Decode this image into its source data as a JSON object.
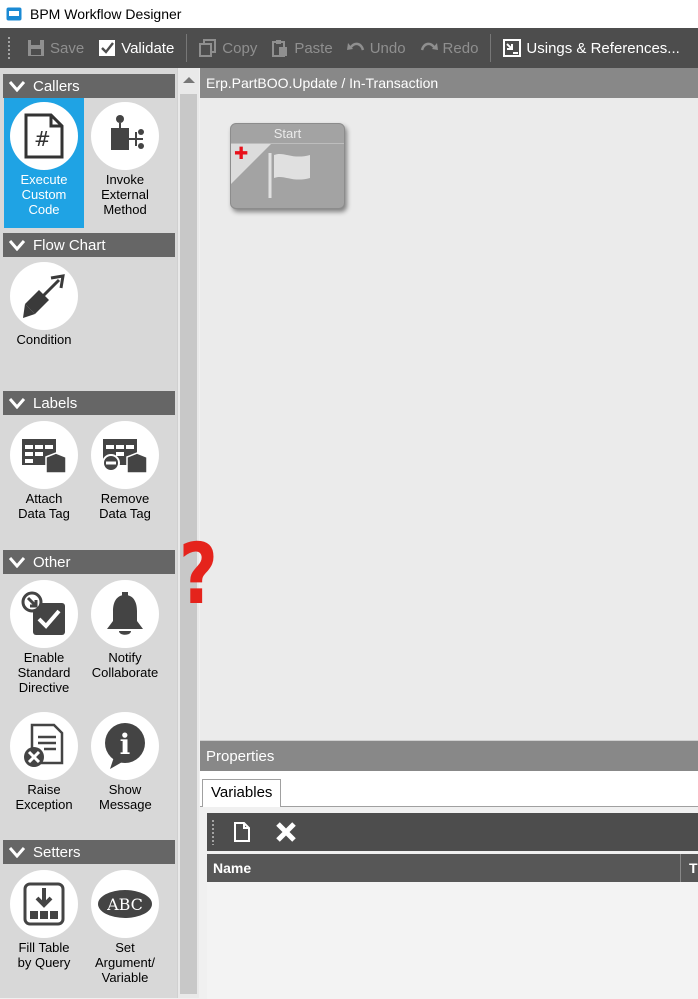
{
  "window": {
    "title": "BPM Workflow Designer",
    "app_icon": "window-icon"
  },
  "toolbar": {
    "save": "Save",
    "validate": "Validate",
    "copy": "Copy",
    "paste": "Paste",
    "undo": "Undo",
    "redo": "Redo",
    "usings": "Usings & References..."
  },
  "palette": {
    "categories": [
      {
        "label": "Callers",
        "tools": [
          {
            "label": "Execute Custom Code",
            "icon": "code-file-icon",
            "selected": true
          },
          {
            "label": "Invoke External Method",
            "icon": "external-method-icon"
          }
        ]
      },
      {
        "label": "Flow Chart",
        "tools": [
          {
            "label": "Condition",
            "icon": "condition-arrows-icon"
          }
        ]
      },
      {
        "label": "Labels",
        "tools": [
          {
            "label": "Attach Data Tag",
            "icon": "attach-tag-icon"
          },
          {
            "label": "Remove Data Tag",
            "icon": "remove-tag-icon"
          }
        ]
      },
      {
        "label": "Other",
        "tools": [
          {
            "label": "Enable Standard Directive",
            "icon": "directive-icon"
          },
          {
            "label": "Notify Collaborate",
            "icon": "bell-icon"
          },
          {
            "label": "Raise Exception",
            "icon": "exception-icon"
          },
          {
            "label": "Show Message",
            "icon": "info-bubble-icon"
          }
        ]
      },
      {
        "label": "Setters",
        "tools": [
          {
            "label": "Fill Table by Query",
            "icon": "fill-table-icon"
          },
          {
            "label": "Set Argument/ Variable",
            "icon": "abc-icon"
          }
        ]
      }
    ]
  },
  "canvas": {
    "header": "Erp.PartBOO.Update / In-Transaction",
    "start_node": {
      "label": "Start"
    }
  },
  "annotation": {
    "mark": "?",
    "color": "#e5231c"
  },
  "properties": {
    "header": "Properties",
    "tab": "Variables",
    "columns": [
      "Name",
      "T"
    ]
  },
  "colors": {
    "accent": "#1fa3e4",
    "toolbar": "#4d4d4d",
    "category": "#666666"
  }
}
